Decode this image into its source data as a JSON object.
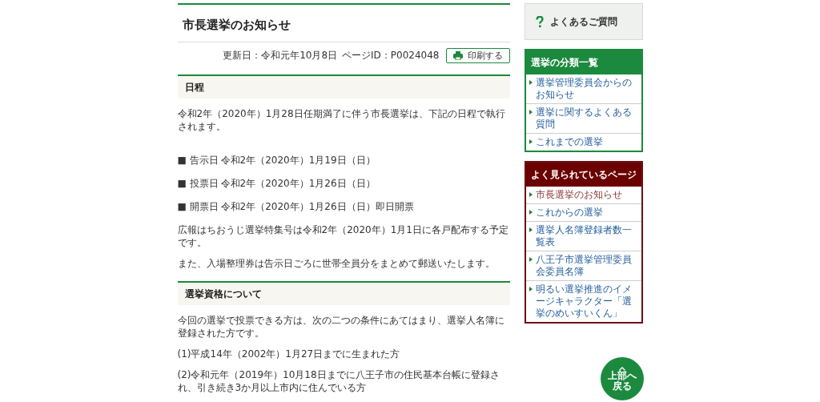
{
  "page_title": "市長選挙のお知らせ",
  "meta": {
    "updated": "更新日：令和元年10月8日",
    "page_id": "ページID：P0024048"
  },
  "print_button": "印刷する",
  "sections": [
    {
      "heading": "日程",
      "blocks": [
        {
          "kind": "paragraph",
          "text": "令和2年（2020年）1月28日任期満了に伴う市長選挙は、下記の日程で執行されます。"
        },
        {
          "kind": "schedule",
          "label": "■ 告示日",
          "value": "令和2年（2020年）1月19日（日）"
        },
        {
          "kind": "schedule",
          "label": "■ 投票日",
          "value": "令和2年（2020年）1月26日（日）"
        },
        {
          "kind": "schedule",
          "label": "■ 開票日",
          "value": "令和2年（2020年）1月26日（日）即日開票"
        },
        {
          "kind": "paragraph",
          "text": "広報はちおうじ選挙特集号は令和2年（2020年）1月1日に各戸配布する予定です。"
        },
        {
          "kind": "paragraph",
          "text": "また、入場整理券は告示日ごろに世帯全員分をまとめて郵送いたします。"
        }
      ]
    },
    {
      "heading": "選挙資格について",
      "blocks": [
        {
          "kind": "paragraph",
          "text": "今回の選挙で投票できる方は、次の二つの条件にあてはまり、選挙人名簿に登録された方です。"
        },
        {
          "kind": "paragraph",
          "text": "(1)平成14年（2002年）1月27日までに生まれた方"
        },
        {
          "kind": "paragraph",
          "text": "(2)令和元年（2019年）10月18日までに八王子市の住民基本台帳に登録され、引き続き3か月以上市内に住んでいる方"
        }
      ]
    }
  ],
  "sidebar": {
    "faq": "よくあるご質問",
    "menus": [
      {
        "kind": "category",
        "title": "選挙の分類一覧",
        "items": [
          {
            "label": "選挙管理委員会からのお知らせ",
            "selected": false
          },
          {
            "label": "選挙に関するよくある質問",
            "selected": false
          },
          {
            "label": "これまでの選挙",
            "selected": false
          }
        ]
      },
      {
        "kind": "popular",
        "title": "よく見られているページ",
        "items": [
          {
            "label": "市長選挙のお知らせ",
            "selected": true
          },
          {
            "label": "これからの選挙",
            "selected": false
          },
          {
            "label": "選挙人名簿登録者数一覧表",
            "selected": false
          },
          {
            "label": "八王子市選挙管理委員会委員名簿",
            "selected": false
          },
          {
            "label": "明るい選挙推進のイメージキャラクター「選挙のめいすいくん」",
            "selected": false
          }
        ]
      }
    ]
  },
  "back_to_top": "上部へ戻る"
}
